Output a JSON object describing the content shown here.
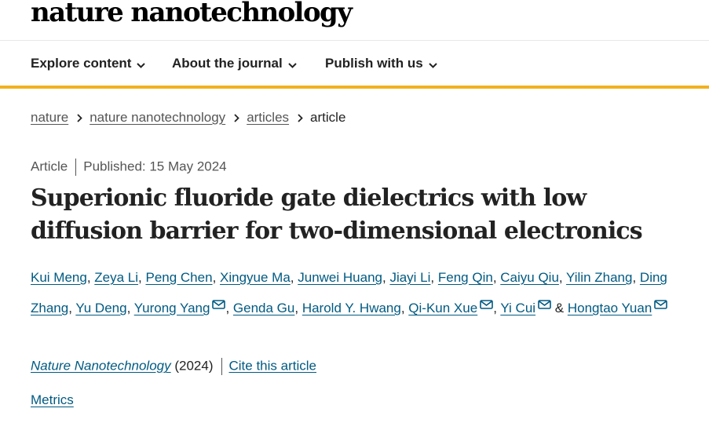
{
  "header": {
    "logo": "nature nanotechnology"
  },
  "nav": [
    {
      "label": "Explore content"
    },
    {
      "label": "About the journal"
    },
    {
      "label": "Publish with us"
    }
  ],
  "breadcrumb": [
    {
      "label": "nature"
    },
    {
      "label": "nature nanotechnology"
    },
    {
      "label": "articles"
    },
    {
      "label": "article"
    }
  ],
  "article": {
    "type": "Article",
    "published": "Published: 15 May 2024",
    "title": "Superionic fluoride gate dielectrics with low diffusion barrier for two-dimensional electronics",
    "authors": [
      {
        "name": "Kui Meng",
        "email": false
      },
      {
        "name": "Zeya Li",
        "email": false
      },
      {
        "name": "Peng Chen",
        "email": false
      },
      {
        "name": "Xingyue Ma",
        "email": false
      },
      {
        "name": "Junwei Huang",
        "email": false
      },
      {
        "name": "Jiayi Li",
        "email": false
      },
      {
        "name": "Feng Qin",
        "email": false
      },
      {
        "name": "Caiyu Qiu",
        "email": false
      },
      {
        "name": "Yilin Zhang",
        "email": false
      },
      {
        "name": "Ding Zhang",
        "email": false
      },
      {
        "name": "Yu Deng",
        "email": false
      },
      {
        "name": "Yurong Yang",
        "email": true
      },
      {
        "name": "Genda Gu",
        "email": false
      },
      {
        "name": "Harold Y. Hwang",
        "email": false
      },
      {
        "name": "Qi-Kun Xue",
        "email": true
      },
      {
        "name": "Yi Cui",
        "email": true
      },
      {
        "name": "Hongtao Yuan",
        "email": true
      }
    ],
    "journal": "Nature Nanotechnology",
    "year": "(2024)",
    "cite_label": "Cite this article",
    "metrics_label": "Metrics"
  },
  "colors": {
    "accent": "#f2b11e",
    "link": "#005a82",
    "text": "#222222"
  },
  "icons": {
    "nav_chevron": "chevron-down-icon",
    "breadcrumb_separator": "chevron-right-icon",
    "author_email": "envelope-icon"
  }
}
